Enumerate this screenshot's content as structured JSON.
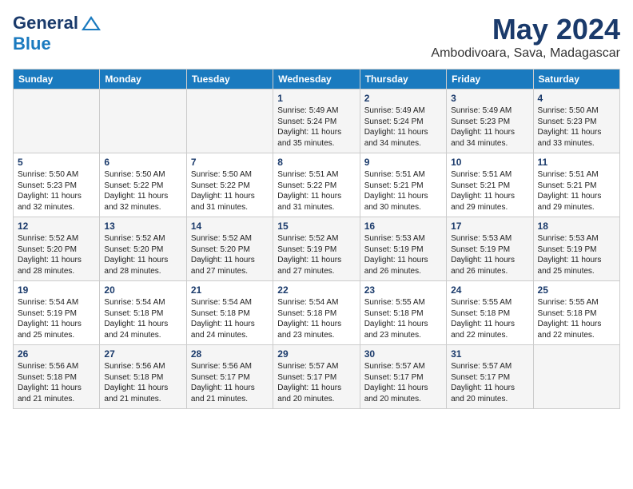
{
  "header": {
    "logo_general": "General",
    "logo_blue": "Blue",
    "month_year": "May 2024",
    "location": "Ambodivoara, Sava, Madagascar"
  },
  "days_of_week": [
    "Sunday",
    "Monday",
    "Tuesday",
    "Wednesday",
    "Thursday",
    "Friday",
    "Saturday"
  ],
  "weeks": [
    [
      {
        "day": "",
        "info": ""
      },
      {
        "day": "",
        "info": ""
      },
      {
        "day": "",
        "info": ""
      },
      {
        "day": "1",
        "info": "Sunrise: 5:49 AM\nSunset: 5:24 PM\nDaylight: 11 hours and 35 minutes."
      },
      {
        "day": "2",
        "info": "Sunrise: 5:49 AM\nSunset: 5:24 PM\nDaylight: 11 hours and 34 minutes."
      },
      {
        "day": "3",
        "info": "Sunrise: 5:49 AM\nSunset: 5:23 PM\nDaylight: 11 hours and 34 minutes."
      },
      {
        "day": "4",
        "info": "Sunrise: 5:50 AM\nSunset: 5:23 PM\nDaylight: 11 hours and 33 minutes."
      }
    ],
    [
      {
        "day": "5",
        "info": "Sunrise: 5:50 AM\nSunset: 5:23 PM\nDaylight: 11 hours and 32 minutes."
      },
      {
        "day": "6",
        "info": "Sunrise: 5:50 AM\nSunset: 5:22 PM\nDaylight: 11 hours and 32 minutes."
      },
      {
        "day": "7",
        "info": "Sunrise: 5:50 AM\nSunset: 5:22 PM\nDaylight: 11 hours and 31 minutes."
      },
      {
        "day": "8",
        "info": "Sunrise: 5:51 AM\nSunset: 5:22 PM\nDaylight: 11 hours and 31 minutes."
      },
      {
        "day": "9",
        "info": "Sunrise: 5:51 AM\nSunset: 5:21 PM\nDaylight: 11 hours and 30 minutes."
      },
      {
        "day": "10",
        "info": "Sunrise: 5:51 AM\nSunset: 5:21 PM\nDaylight: 11 hours and 29 minutes."
      },
      {
        "day": "11",
        "info": "Sunrise: 5:51 AM\nSunset: 5:21 PM\nDaylight: 11 hours and 29 minutes."
      }
    ],
    [
      {
        "day": "12",
        "info": "Sunrise: 5:52 AM\nSunset: 5:20 PM\nDaylight: 11 hours and 28 minutes."
      },
      {
        "day": "13",
        "info": "Sunrise: 5:52 AM\nSunset: 5:20 PM\nDaylight: 11 hours and 28 minutes."
      },
      {
        "day": "14",
        "info": "Sunrise: 5:52 AM\nSunset: 5:20 PM\nDaylight: 11 hours and 27 minutes."
      },
      {
        "day": "15",
        "info": "Sunrise: 5:52 AM\nSunset: 5:19 PM\nDaylight: 11 hours and 27 minutes."
      },
      {
        "day": "16",
        "info": "Sunrise: 5:53 AM\nSunset: 5:19 PM\nDaylight: 11 hours and 26 minutes."
      },
      {
        "day": "17",
        "info": "Sunrise: 5:53 AM\nSunset: 5:19 PM\nDaylight: 11 hours and 26 minutes."
      },
      {
        "day": "18",
        "info": "Sunrise: 5:53 AM\nSunset: 5:19 PM\nDaylight: 11 hours and 25 minutes."
      }
    ],
    [
      {
        "day": "19",
        "info": "Sunrise: 5:54 AM\nSunset: 5:19 PM\nDaylight: 11 hours and 25 minutes."
      },
      {
        "day": "20",
        "info": "Sunrise: 5:54 AM\nSunset: 5:18 PM\nDaylight: 11 hours and 24 minutes."
      },
      {
        "day": "21",
        "info": "Sunrise: 5:54 AM\nSunset: 5:18 PM\nDaylight: 11 hours and 24 minutes."
      },
      {
        "day": "22",
        "info": "Sunrise: 5:54 AM\nSunset: 5:18 PM\nDaylight: 11 hours and 23 minutes."
      },
      {
        "day": "23",
        "info": "Sunrise: 5:55 AM\nSunset: 5:18 PM\nDaylight: 11 hours and 23 minutes."
      },
      {
        "day": "24",
        "info": "Sunrise: 5:55 AM\nSunset: 5:18 PM\nDaylight: 11 hours and 22 minutes."
      },
      {
        "day": "25",
        "info": "Sunrise: 5:55 AM\nSunset: 5:18 PM\nDaylight: 11 hours and 22 minutes."
      }
    ],
    [
      {
        "day": "26",
        "info": "Sunrise: 5:56 AM\nSunset: 5:18 PM\nDaylight: 11 hours and 21 minutes."
      },
      {
        "day": "27",
        "info": "Sunrise: 5:56 AM\nSunset: 5:18 PM\nDaylight: 11 hours and 21 minutes."
      },
      {
        "day": "28",
        "info": "Sunrise: 5:56 AM\nSunset: 5:17 PM\nDaylight: 11 hours and 21 minutes."
      },
      {
        "day": "29",
        "info": "Sunrise: 5:57 AM\nSunset: 5:17 PM\nDaylight: 11 hours and 20 minutes."
      },
      {
        "day": "30",
        "info": "Sunrise: 5:57 AM\nSunset: 5:17 PM\nDaylight: 11 hours and 20 minutes."
      },
      {
        "day": "31",
        "info": "Sunrise: 5:57 AM\nSunset: 5:17 PM\nDaylight: 11 hours and 20 minutes."
      },
      {
        "day": "",
        "info": ""
      }
    ]
  ]
}
